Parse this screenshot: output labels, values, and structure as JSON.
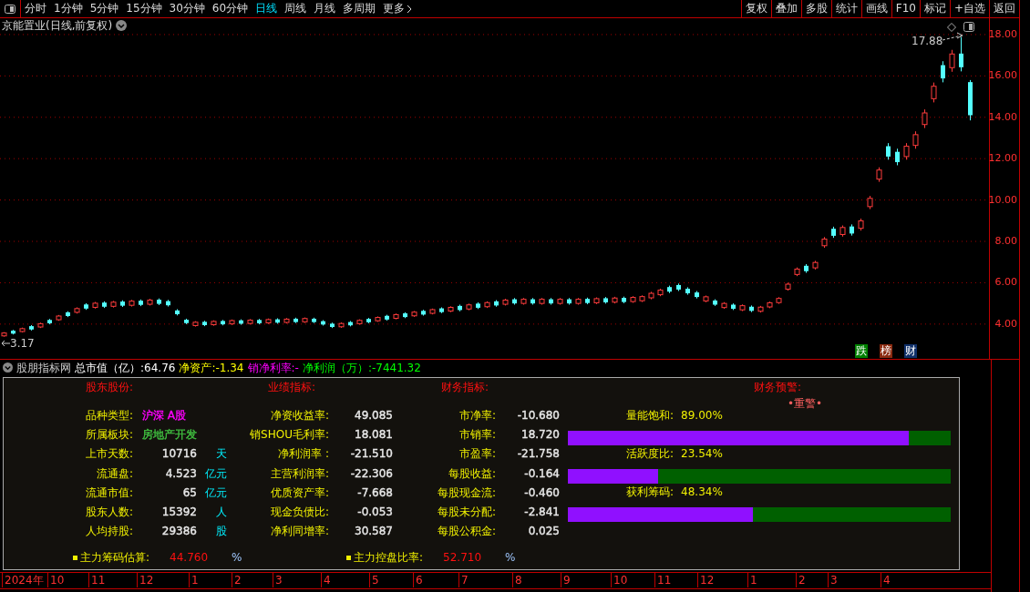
{
  "toolbar": {
    "periods": [
      {
        "label": "分时",
        "selected": false
      },
      {
        "label": "1分钟",
        "selected": false
      },
      {
        "label": "5分钟",
        "selected": false
      },
      {
        "label": "15分钟",
        "selected": false
      },
      {
        "label": "30分钟",
        "selected": false
      },
      {
        "label": "60分钟",
        "selected": false
      },
      {
        "label": "日线",
        "selected": true
      },
      {
        "label": "周线",
        "selected": false
      },
      {
        "label": "月线",
        "selected": false
      },
      {
        "label": "多周期",
        "selected": false
      }
    ],
    "more": "更多",
    "actions": [
      "复权",
      "叠加",
      "多股",
      "统计",
      "画线",
      "F10",
      "标记",
      "+自选",
      "返回"
    ]
  },
  "chart": {
    "title": "京能置业(日线,前复权)",
    "high_label": "17.88",
    "low_label": "3.17",
    "chart_data": {
      "type": "candlestick",
      "grid": true,
      "ylim": [
        2.32,
        18.79
      ],
      "yticks": [
        {
          "value": 18,
          "label": "18.00"
        },
        {
          "value": 16,
          "label": "16.00"
        },
        {
          "value": 14,
          "label": "14.00"
        },
        {
          "value": 12,
          "label": "12.00"
        },
        {
          "value": 10,
          "label": "10.00"
        },
        {
          "value": 8,
          "label": "8.00"
        },
        {
          "value": 6,
          "label": "6.00"
        },
        {
          "value": 4,
          "label": "4.00"
        }
      ],
      "ohlc": [
        [
          3.43,
          3.61,
          3.39,
          3.57
        ],
        [
          3.68,
          3.72,
          3.5,
          3.54
        ],
        [
          3.64,
          3.83,
          3.6,
          3.78
        ],
        [
          3.9,
          3.95,
          3.69,
          3.74
        ],
        [
          3.86,
          4.07,
          3.81,
          4.02
        ],
        [
          4.2,
          4.25,
          3.99,
          4.04
        ],
        [
          4.21,
          4.44,
          4.16,
          4.39
        ],
        [
          4.57,
          4.62,
          4.34,
          4.39
        ],
        [
          4.57,
          4.81,
          4.51,
          4.75
        ],
        [
          4.95,
          5.01,
          4.69,
          4.75
        ],
        [
          4.81,
          5.07,
          4.75,
          5.01
        ],
        [
          5.04,
          5.1,
          4.78,
          4.84
        ],
        [
          4.86,
          5.12,
          4.8,
          5.06
        ],
        [
          5.09,
          5.15,
          4.83,
          4.89
        ],
        [
          4.91,
          5.17,
          4.85,
          5.11
        ],
        [
          5.13,
          5.19,
          4.87,
          4.93
        ],
        [
          4.96,
          5.22,
          4.9,
          5.16
        ],
        [
          5.18,
          5.24,
          4.92,
          4.98
        ],
        [
          5.11,
          5.17,
          4.85,
          4.91
        ],
        [
          4.66,
          4.72,
          4.42,
          4.48
        ],
        [
          4.21,
          4.26,
          4.0,
          4.05
        ],
        [
          3.93,
          4.14,
          3.88,
          4.09
        ],
        [
          4.11,
          4.16,
          3.9,
          3.95
        ],
        [
          3.97,
          4.18,
          3.92,
          4.13
        ],
        [
          4.15,
          4.2,
          3.94,
          3.99
        ],
        [
          4.01,
          4.22,
          3.96,
          4.17
        ],
        [
          4.18,
          4.23,
          3.97,
          4.02
        ],
        [
          4.03,
          4.24,
          3.98,
          4.19
        ],
        [
          4.2,
          4.25,
          3.99,
          4.04
        ],
        [
          4.06,
          4.27,
          4.01,
          4.22
        ],
        [
          4.23,
          4.28,
          4.02,
          4.07
        ],
        [
          4.08,
          4.29,
          4.03,
          4.24
        ],
        [
          4.26,
          4.31,
          4.05,
          4.1
        ],
        [
          4.11,
          4.32,
          4.06,
          4.27
        ],
        [
          4.26,
          4.31,
          4.05,
          4.1
        ],
        [
          4.14,
          4.19,
          3.93,
          3.98
        ],
        [
          4.02,
          4.07,
          3.81,
          3.86
        ],
        [
          3.87,
          4.08,
          3.82,
          4.03
        ],
        [
          4.1,
          4.15,
          3.89,
          3.94
        ],
        [
          4.02,
          4.23,
          3.97,
          4.18
        ],
        [
          4.25,
          4.3,
          4.04,
          4.09
        ],
        [
          4.16,
          4.37,
          4.11,
          4.32
        ],
        [
          4.4,
          4.45,
          4.17,
          4.22
        ],
        [
          4.28,
          4.51,
          4.23,
          4.46
        ],
        [
          4.52,
          4.57,
          4.29,
          4.34
        ],
        [
          4.4,
          4.63,
          4.35,
          4.58
        ],
        [
          4.64,
          4.69,
          4.41,
          4.46
        ],
        [
          4.52,
          4.75,
          4.47,
          4.7
        ],
        [
          4.76,
          4.81,
          4.53,
          4.58
        ],
        [
          4.63,
          4.86,
          4.58,
          4.81
        ],
        [
          4.88,
          4.94,
          4.62,
          4.68
        ],
        [
          4.73,
          4.99,
          4.67,
          4.93
        ],
        [
          4.99,
          5.05,
          4.73,
          4.79
        ],
        [
          4.84,
          5.1,
          4.78,
          5.04
        ],
        [
          5.1,
          5.16,
          4.84,
          4.9
        ],
        [
          4.96,
          5.22,
          4.9,
          5.16
        ],
        [
          5.2,
          5.26,
          4.94,
          5.0
        ],
        [
          5.0,
          5.26,
          4.94,
          5.2
        ],
        [
          5.2,
          5.26,
          4.94,
          5.0
        ],
        [
          5.0,
          5.26,
          4.94,
          5.2
        ],
        [
          5.2,
          5.26,
          4.94,
          5.0
        ],
        [
          5.0,
          5.26,
          4.94,
          5.2
        ],
        [
          5.2,
          5.26,
          4.94,
          5.0
        ],
        [
          5.0,
          5.26,
          4.94,
          5.2
        ],
        [
          5.22,
          5.28,
          4.96,
          5.02
        ],
        [
          5.03,
          5.29,
          4.97,
          5.23
        ],
        [
          5.25,
          5.31,
          4.99,
          5.05
        ],
        [
          5.06,
          5.32,
          5.0,
          5.26
        ],
        [
          5.27,
          5.33,
          5.01,
          5.07
        ],
        [
          5.09,
          5.35,
          5.03,
          5.29
        ],
        [
          5.13,
          5.39,
          5.07,
          5.33
        ],
        [
          5.27,
          5.56,
          5.2,
          5.49
        ],
        [
          5.42,
          5.71,
          5.35,
          5.64
        ],
        [
          5.79,
          5.86,
          5.5,
          5.57
        ],
        [
          5.89,
          5.96,
          5.6,
          5.67
        ],
        [
          5.71,
          5.78,
          5.42,
          5.49
        ],
        [
          5.53,
          5.6,
          5.24,
          5.31
        ],
        [
          5.12,
          5.38,
          5.06,
          5.32
        ],
        [
          5.14,
          5.2,
          4.88,
          4.94
        ],
        [
          4.8,
          5.06,
          4.74,
          5.0
        ],
        [
          4.94,
          5.0,
          4.68,
          4.74
        ],
        [
          4.69,
          4.95,
          4.63,
          4.89
        ],
        [
          4.84,
          4.9,
          4.58,
          4.64
        ],
        [
          4.62,
          4.88,
          4.56,
          4.82
        ],
        [
          4.83,
          5.09,
          4.77,
          5.03
        ],
        [
          5.04,
          5.3,
          4.98,
          5.24
        ],
        [
          5.69,
          6.0,
          5.62,
          5.93
        ],
        [
          6.4,
          6.74,
          6.32,
          6.66
        ],
        [
          6.82,
          6.9,
          6.48,
          6.56
        ],
        [
          6.72,
          7.06,
          6.64,
          6.98
        ],
        [
          7.79,
          8.21,
          7.69,
          8.11
        ],
        [
          8.61,
          8.71,
          8.17,
          8.27
        ],
        [
          8.33,
          8.77,
          8.23,
          8.67
        ],
        [
          8.72,
          8.82,
          8.28,
          8.38
        ],
        [
          8.63,
          9.1,
          8.52,
          8.99
        ],
        [
          9.68,
          10.2,
          9.56,
          10.08
        ],
        [
          11.01,
          11.58,
          10.88,
          11.45
        ],
        [
          12.6,
          12.75,
          11.95,
          12.1
        ],
        [
          12.33,
          12.48,
          11.68,
          11.83
        ],
        [
          12.1,
          12.75,
          11.95,
          12.6
        ],
        [
          12.64,
          13.32,
          12.48,
          13.16
        ],
        [
          13.65,
          14.38,
          13.48,
          14.21
        ],
        [
          14.9,
          15.68,
          14.72,
          15.5
        ],
        [
          16.52,
          16.71,
          15.69,
          15.88
        ],
        [
          16.4,
          17.26,
          16.2,
          17.06
        ],
        [
          17.08,
          17.88,
          16.22,
          16.42
        ],
        [
          15.7,
          15.8,
          13.85,
          14.1
        ]
      ]
    },
    "badges": [
      {
        "label": "跌",
        "color": "#008000"
      },
      {
        "label": "榜",
        "color": "#8a2a10"
      },
      {
        "label": "财",
        "color": "#10306a"
      }
    ]
  },
  "indicator": {
    "name": "股朋指标网",
    "items": [
      {
        "text": "总市值（亿）:64.76",
        "color": "#ffffff"
      },
      {
        "text": "净资产:-1.34",
        "color": "#ffff00"
      },
      {
        "text": "销净利率:-",
        "color": "#ff00ff"
      },
      {
        "text": "净利润（万）:-7441.32",
        "color": "#00ff00"
      }
    ]
  },
  "panel": {
    "headers": [
      "股东股份:",
      "业绩指标:",
      "财务指标:",
      "财务预警:"
    ],
    "shareholder_rows": [
      {
        "label": "品种类型:",
        "value": "沪深 A股",
        "color": "#ff00ff"
      },
      {
        "label": "所属板块:",
        "value": "房地产开发",
        "color": "#40c040"
      },
      {
        "label": "上市天数:",
        "value": "10716",
        "unit": "天",
        "color": "#e8e8e8"
      },
      {
        "label": "流通盘:",
        "value": "4.523",
        "unit": "亿元",
        "color": "#e8e8e8"
      },
      {
        "label": "流通市值:",
        "value": "65",
        "unit": "亿元",
        "color": "#e8e8e8"
      },
      {
        "label": "股东人数:",
        "value": "15392",
        "unit": "人",
        "color": "#e8e8e8"
      },
      {
        "label": "人均持股:",
        "value": "29386",
        "unit": "股",
        "color": "#e8e8e8"
      }
    ],
    "performance_rows": [
      {
        "label": "净资收益率:",
        "value": "49.085"
      },
      {
        "label": "销SHOU毛利率:",
        "value": "18.081"
      },
      {
        "label": "净利润率 :",
        "value": "-21.510"
      },
      {
        "label": "主营利润率:",
        "value": "-22.306"
      },
      {
        "label": "优质资产率:",
        "value": "-7.668"
      },
      {
        "label": "现金负债比:",
        "value": "-0.053"
      },
      {
        "label": "净利同增率:",
        "value": "30.587"
      }
    ],
    "finance_rows": [
      {
        "label": "市净率:",
        "value": "-10.680"
      },
      {
        "label": "市销率:",
        "value": "18.720"
      },
      {
        "label": "市盈率:",
        "value": "-21.758"
      },
      {
        "label": "每股收益:",
        "value": "-0.164"
      },
      {
        "label": "每股现金流:",
        "value": "-0.460"
      },
      {
        "label": "每股未分配:",
        "value": "-2.841"
      },
      {
        "label": "每股公积金:",
        "value": "0.025"
      }
    ],
    "warning": "•重警•",
    "meters": [
      {
        "label": "量能饱和:",
        "reading": "89.00%",
        "level": 0.89
      },
      {
        "label": "活跃度比:",
        "reading": "23.54%",
        "level": 0.2354
      },
      {
        "label": "获利筹码:",
        "reading": "48.34%",
        "level": 0.4834
      }
    ],
    "summary": [
      {
        "label": "主力筹码估算:",
        "value": "44.760",
        "unit": "%"
      },
      {
        "label": "主力控盘比率:",
        "value": "52.710",
        "unit": "%"
      }
    ]
  },
  "date_axis": [
    "2024年",
    "10",
    "11",
    "12",
    "1",
    "2",
    "3",
    "4",
    "5",
    "6",
    "7",
    "8",
    "9",
    "10",
    "11",
    "12",
    "1",
    "2",
    "3",
    "4"
  ]
}
